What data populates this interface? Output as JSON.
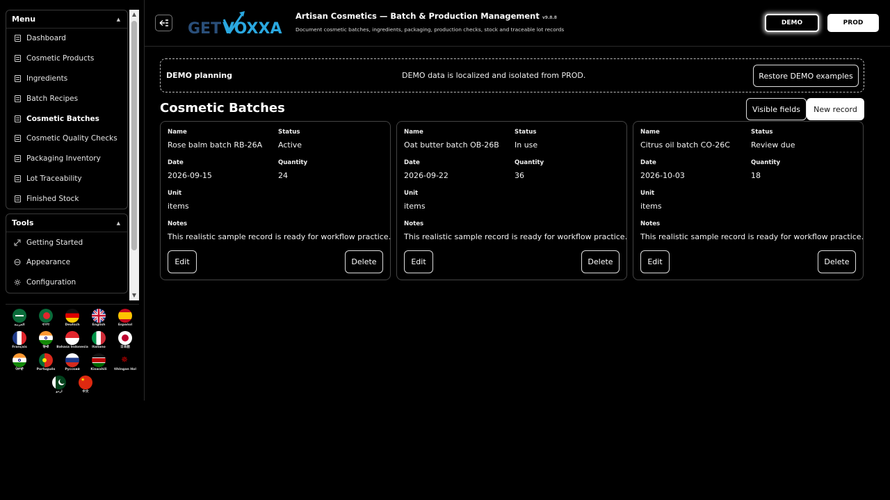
{
  "sidebar": {
    "menu_title": "Menu",
    "menu_items": [
      {
        "label": "Dashboard",
        "icon": "document-icon",
        "active": false
      },
      {
        "label": "Cosmetic Products",
        "icon": "document-icon",
        "active": false
      },
      {
        "label": "Ingredients",
        "icon": "document-icon",
        "active": false
      },
      {
        "label": "Batch Recipes",
        "icon": "document-icon",
        "active": false
      },
      {
        "label": "Cosmetic Batches",
        "icon": "document-icon",
        "active": true
      },
      {
        "label": "Cosmetic Quality Checks",
        "icon": "document-icon",
        "active": false
      },
      {
        "label": "Packaging Inventory",
        "icon": "document-icon",
        "active": false
      },
      {
        "label": "Lot Traceability",
        "icon": "document-icon",
        "active": false
      },
      {
        "label": "Finished Stock",
        "icon": "document-icon",
        "active": false
      }
    ],
    "tools_title": "Tools",
    "tools_items": [
      {
        "label": "Getting Started",
        "icon": "rocket-icon"
      },
      {
        "label": "Appearance",
        "icon": "palette-icon"
      },
      {
        "label": "Configuration",
        "icon": "gear-icon"
      }
    ],
    "languages": [
      {
        "label": "العربية",
        "flag": "sa"
      },
      {
        "label": "বাংলা",
        "flag": "bd"
      },
      {
        "label": "Deutsch",
        "flag": "de"
      },
      {
        "label": "English",
        "flag": "gb"
      },
      {
        "label": "Español",
        "flag": "es"
      },
      {
        "label": "Français",
        "flag": "fr"
      },
      {
        "label": "हिन्दी",
        "flag": "in"
      },
      {
        "label": "Bahasa Indonesia",
        "flag": "id"
      },
      {
        "label": "Italiano",
        "flag": "it"
      },
      {
        "label": "日本語",
        "flag": "jp"
      },
      {
        "label": "ਪੰਜਾਬੀ",
        "flag": "in"
      },
      {
        "label": "Português",
        "flag": "pt"
      },
      {
        "label": "Русский",
        "flag": "ru"
      },
      {
        "label": "Kiswahili",
        "flag": "ke"
      },
      {
        "label": "tlhIngan Hol",
        "flag": "kl"
      },
      {
        "label": "اردو",
        "flag": "pk"
      },
      {
        "label": "中文",
        "flag": "cn"
      }
    ]
  },
  "header": {
    "logo_text": "GETVOXXA",
    "title": "Artisan Cosmetics — Batch & Production Management",
    "version": "v9.8.8",
    "subtitle": "Document cosmetic batches, ingredients, packaging, production checks, stock and traceable lot records",
    "env_demo": "DEMO",
    "env_prod": "PROD"
  },
  "banner": {
    "title": "DEMO planning",
    "message": "DEMO data is localized and isolated from PROD.",
    "restore_label": "Restore DEMO examples"
  },
  "main": {
    "title": "Cosmetic Batches",
    "visible_fields_label": "Visible fields",
    "new_record_label": "New record",
    "field_labels": {
      "name": "Name",
      "status": "Status",
      "date": "Date",
      "quantity": "Quantity",
      "unit": "Unit",
      "notes": "Notes"
    },
    "edit_label": "Edit",
    "delete_label": "Delete",
    "records": [
      {
        "name": "Rose balm batch RB-26A",
        "status": "Active",
        "date": "2026-09-15",
        "quantity": "24",
        "unit": "items",
        "notes": "This realistic sample record is ready for workflow practice."
      },
      {
        "name": "Oat butter batch OB-26B",
        "status": "In use",
        "date": "2026-09-22",
        "quantity": "36",
        "unit": "items",
        "notes": "This realistic sample record is ready for workflow practice."
      },
      {
        "name": "Citrus oil batch CO-26C",
        "status": "Review due",
        "date": "2026-10-03",
        "quantity": "18",
        "unit": "items",
        "notes": "This realistic sample record is ready for workflow practice."
      }
    ]
  },
  "colors": {
    "background": "#000000",
    "text": "#ffffff",
    "logo_dark": "#1f3a5f",
    "logo_light": "#2aa8e0"
  }
}
